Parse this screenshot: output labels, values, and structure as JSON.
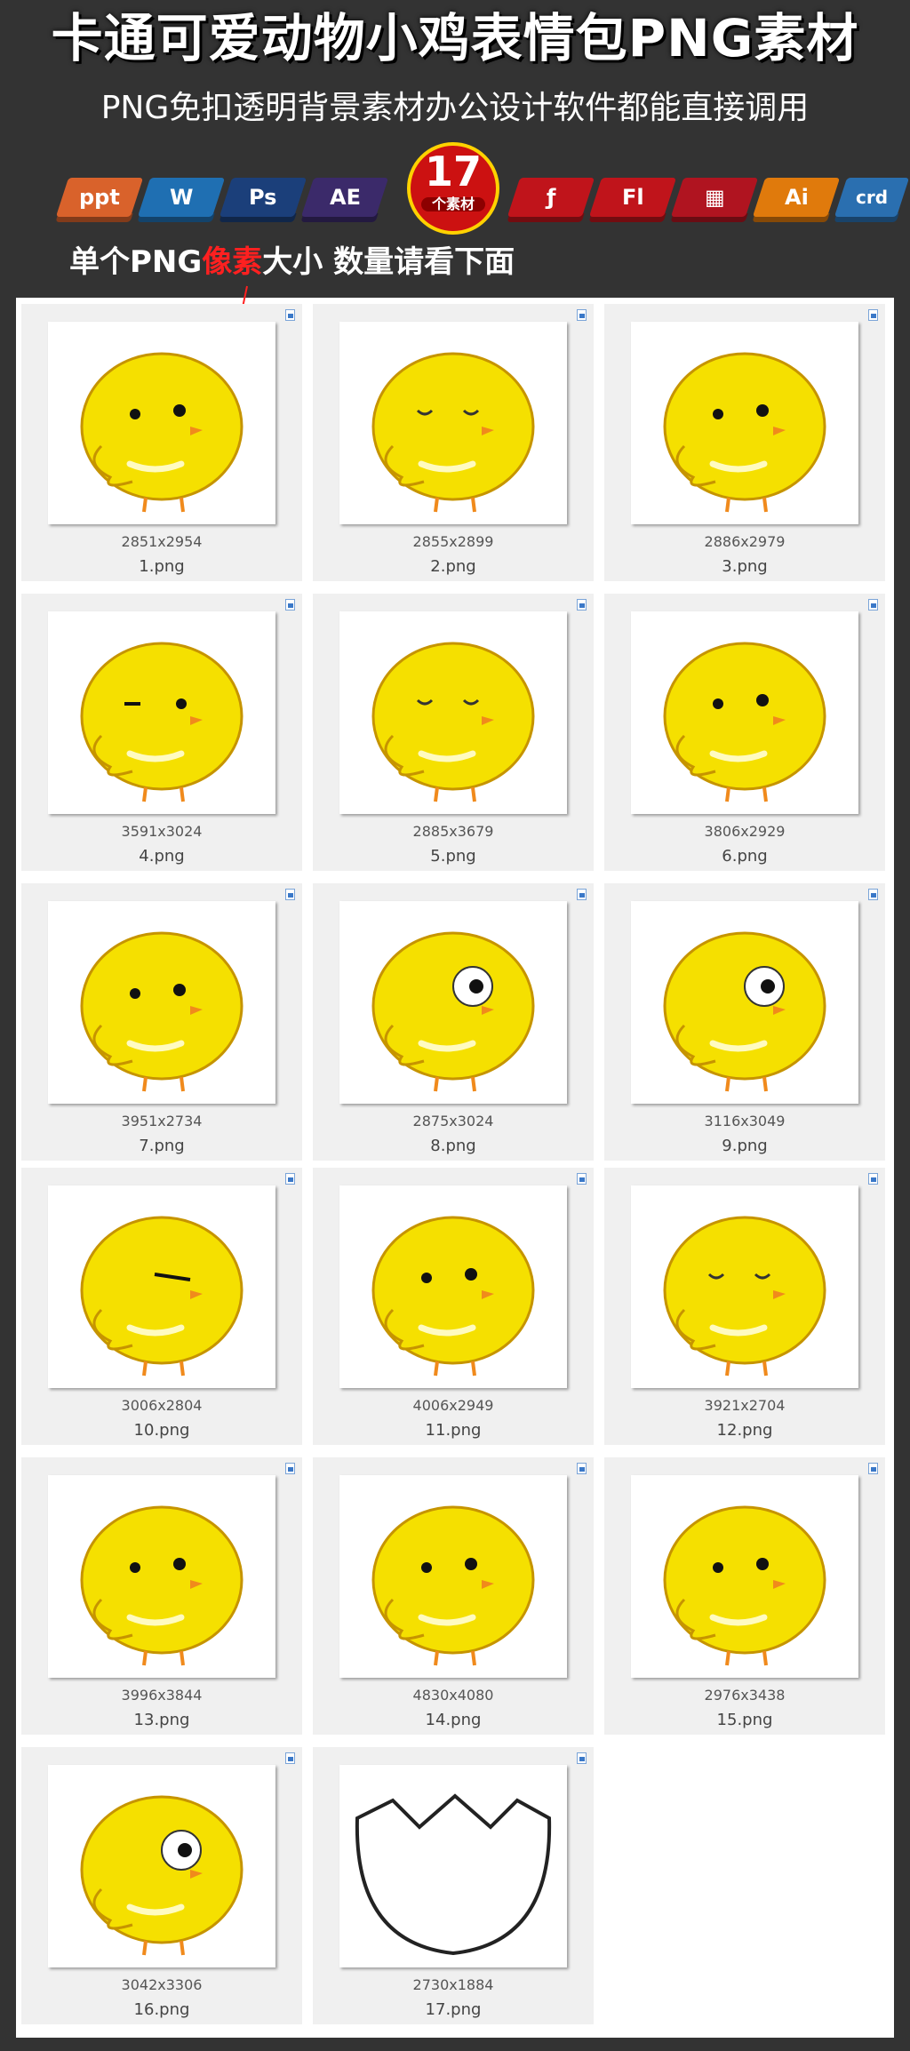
{
  "header": {
    "title": "卡通可爱动物小鸡表情包PNG素材",
    "subtitle": "PNG免扣透明背景素材办公设计软件都能直接调用",
    "caption_part1": "单个PNG",
    "caption_red": "像素",
    "caption_part2": "大小 数量请看下面",
    "badge_number": "17",
    "badge_text": "个素材"
  },
  "software_icons": [
    {
      "name": "ppt",
      "label": "ppt",
      "color": "#d9622b"
    },
    {
      "name": "wordpress",
      "label": "W",
      "color": "#1f6fb2"
    },
    {
      "name": "photoshop",
      "label": "Ps",
      "color": "#1b3f7a"
    },
    {
      "name": "after-effects",
      "label": "AE",
      "color": "#3b2a6a"
    },
    {
      "name": "flash",
      "label": "ƒ",
      "color": "#c0141b"
    },
    {
      "name": "flash-fl",
      "label": "Fl",
      "color": "#c0141b"
    },
    {
      "name": "video",
      "label": "▦",
      "color": "#b01420"
    },
    {
      "name": "illustrator",
      "label": "Ai",
      "color": "#e07a0c"
    },
    {
      "name": "coreldraw",
      "label": "crd",
      "color": "#2a6fb0"
    }
  ],
  "files": [
    {
      "dimensions": "2851x2954",
      "filename": "1.png"
    },
    {
      "dimensions": "2855x2899",
      "filename": "2.png"
    },
    {
      "dimensions": "2886x2979",
      "filename": "3.png"
    },
    {
      "dimensions": "3591x3024",
      "filename": "4.png"
    },
    {
      "dimensions": "2885x3679",
      "filename": "5.png"
    },
    {
      "dimensions": "3806x2929",
      "filename": "6.png"
    },
    {
      "dimensions": "3951x2734",
      "filename": "7.png"
    },
    {
      "dimensions": "2875x3024",
      "filename": "8.png"
    },
    {
      "dimensions": "3116x3049",
      "filename": "9.png"
    },
    {
      "dimensions": "3006x2804",
      "filename": "10.png"
    },
    {
      "dimensions": "4006x2949",
      "filename": "11.png"
    },
    {
      "dimensions": "3921x2704",
      "filename": "12.png"
    },
    {
      "dimensions": "3996x3844",
      "filename": "13.png"
    },
    {
      "dimensions": "4830x4080",
      "filename": "14.png"
    },
    {
      "dimensions": "2976x3438",
      "filename": "15.png"
    },
    {
      "dimensions": "3042x3306",
      "filename": "16.png"
    },
    {
      "dimensions": "2730x1884",
      "filename": "17.png"
    }
  ],
  "colors": {
    "background": "#333333",
    "chick_yellow": "#f5e000",
    "chick_outline": "#c69400",
    "beak": "#f08a1c",
    "accent_red": "#ff2020"
  }
}
